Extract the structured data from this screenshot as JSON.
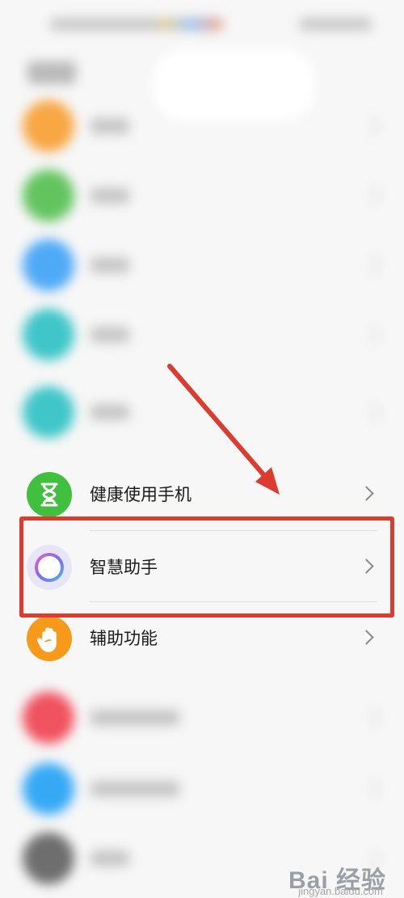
{
  "items": [
    {
      "label": "健康使用手机",
      "icon": "hourglass-icon",
      "color": "#41c03f"
    },
    {
      "label": "智慧助手",
      "icon": "voice-assistant-ring-icon",
      "color": "#8f7df0"
    },
    {
      "label": "辅助功能",
      "icon": "hand-icon",
      "color": "#f79a1c"
    }
  ],
  "blurred_icon_colors": [
    "#f8a744",
    "#62c45f",
    "#4eaaf6",
    "#3fc6c9",
    "#3fc6c9",
    "#f0525f",
    "#36a9f5",
    "#6e6e6e"
  ],
  "annotation": {
    "box_color": "#dd3a30",
    "arrow_color": "#dd3a30"
  },
  "watermark": {
    "brand": "Bai  经验",
    "sub": "jingyan.baidu.com"
  }
}
